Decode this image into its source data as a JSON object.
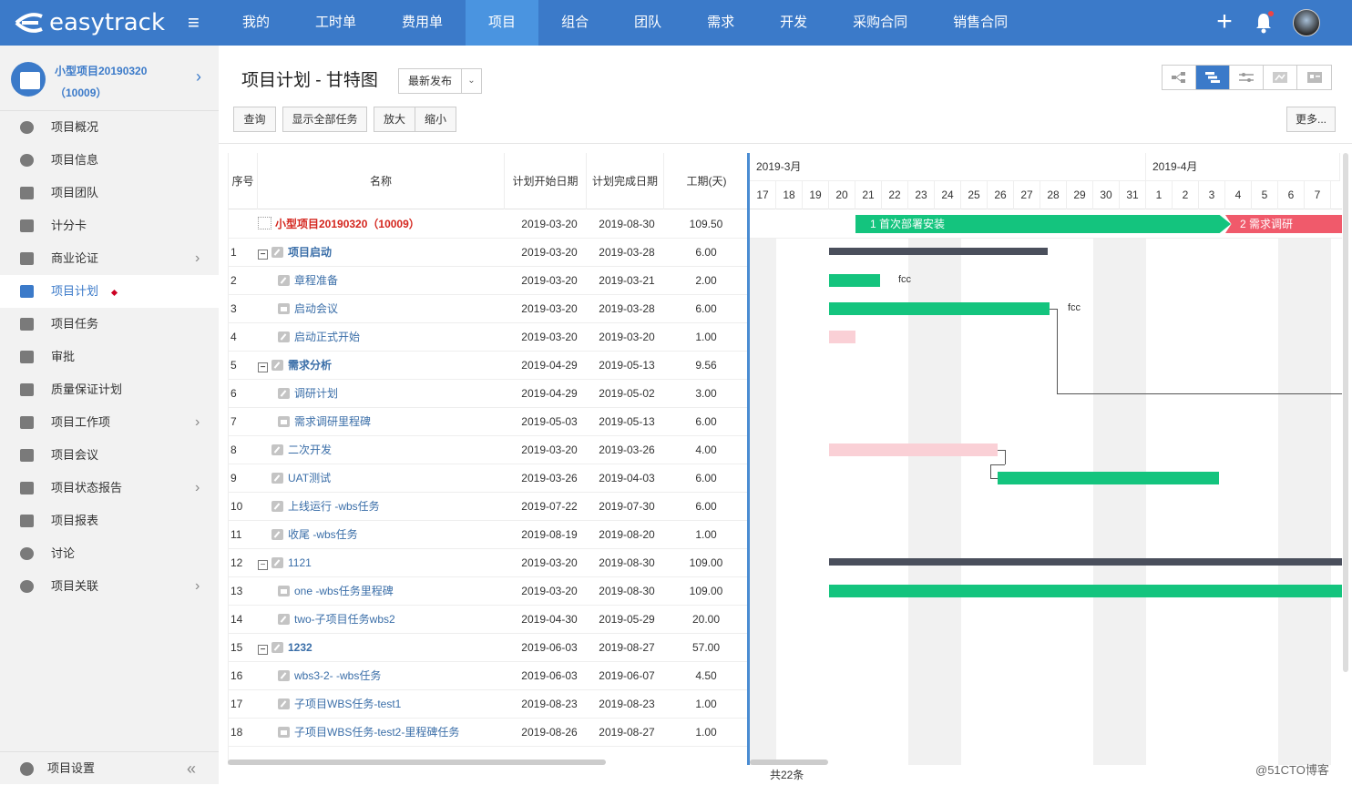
{
  "app": {
    "logo_text": "easytrack"
  },
  "nav": {
    "items": [
      {
        "label": "我的",
        "active": false
      },
      {
        "label": "工时单",
        "active": false
      },
      {
        "label": "费用单",
        "active": false
      },
      {
        "label": "项目",
        "active": true
      },
      {
        "label": "组合",
        "active": false
      },
      {
        "label": "团队",
        "active": false
      },
      {
        "label": "需求",
        "active": false
      },
      {
        "label": "开发",
        "active": false
      },
      {
        "label": "采购合同",
        "active": false
      },
      {
        "label": "销售合同",
        "active": false
      }
    ]
  },
  "sidebar": {
    "project_name": "小型项目20190320（10009）",
    "items": [
      {
        "label": "项目概况",
        "arrow": false,
        "active": false,
        "icon": "pie-chart-icon"
      },
      {
        "label": "项目信息",
        "arrow": false,
        "active": false,
        "icon": "info-icon"
      },
      {
        "label": "项目团队",
        "arrow": false,
        "active": false,
        "icon": "team-icon"
      },
      {
        "label": "计分卡",
        "arrow": false,
        "active": false,
        "icon": "scorecard-icon"
      },
      {
        "label": "商业论证",
        "arrow": true,
        "active": false,
        "icon": "flag-icon"
      },
      {
        "label": "项目计划",
        "arrow": false,
        "active": true,
        "icon": "plan-icon"
      },
      {
        "label": "项目任务",
        "arrow": false,
        "active": false,
        "icon": "task-icon"
      },
      {
        "label": "审批",
        "arrow": false,
        "active": false,
        "icon": "approval-icon"
      },
      {
        "label": "质量保证计划",
        "arrow": false,
        "active": false,
        "icon": "shield-icon"
      },
      {
        "label": "项目工作项",
        "arrow": true,
        "active": false,
        "icon": "list-icon"
      },
      {
        "label": "项目会议",
        "arrow": false,
        "active": false,
        "icon": "meeting-icon"
      },
      {
        "label": "项目状态报告",
        "arrow": true,
        "active": false,
        "icon": "report-icon"
      },
      {
        "label": "项目报表",
        "arrow": false,
        "active": false,
        "icon": "chart-icon"
      },
      {
        "label": "讨论",
        "arrow": false,
        "active": false,
        "icon": "chat-icon"
      },
      {
        "label": "项目关联",
        "arrow": true,
        "active": false,
        "icon": "link-icon"
      }
    ],
    "footer_label": "项目设置"
  },
  "page": {
    "title": "项目计划 - 甘特图",
    "version_select": "最新发布",
    "buttons": {
      "query": "查询",
      "show_all": "显示全部任务",
      "zoom_in": "放大",
      "zoom_out": "缩小",
      "more": "更多..."
    }
  },
  "grid": {
    "headers": {
      "seq": "序号",
      "name": "名称",
      "start": "计划开始日期",
      "end": "计划完成日期",
      "duration": "工期(天)"
    },
    "rows": [
      {
        "seq": "",
        "name": "小型项目20190320（10009）",
        "start": "2019-03-20",
        "end": "2019-08-30",
        "dur": "109.50",
        "type": "root",
        "level": 0
      },
      {
        "seq": "1",
        "name": "项目启动",
        "start": "2019-03-20",
        "end": "2019-03-28",
        "dur": "6.00",
        "type": "summary",
        "level": 1
      },
      {
        "seq": "2",
        "name": "章程准备",
        "start": "2019-03-20",
        "end": "2019-03-21",
        "dur": "2.00",
        "type": "task",
        "level": 2
      },
      {
        "seq": "3",
        "name": "启动会议",
        "start": "2019-03-20",
        "end": "2019-03-28",
        "dur": "6.00",
        "type": "milestone",
        "level": 2
      },
      {
        "seq": "4",
        "name": "启动正式开始",
        "start": "2019-03-20",
        "end": "2019-03-20",
        "dur": "1.00",
        "type": "task",
        "level": 2
      },
      {
        "seq": "5",
        "name": "需求分析",
        "start": "2019-04-29",
        "end": "2019-05-13",
        "dur": "9.56",
        "type": "summary",
        "level": 1
      },
      {
        "seq": "6",
        "name": "调研计划",
        "start": "2019-04-29",
        "end": "2019-05-02",
        "dur": "3.00",
        "type": "task",
        "level": 2
      },
      {
        "seq": "7",
        "name": "需求调研里程碑",
        "start": "2019-05-03",
        "end": "2019-05-13",
        "dur": "6.00",
        "type": "milestone",
        "level": 2
      },
      {
        "seq": "8",
        "name": "二次开发",
        "start": "2019-03-20",
        "end": "2019-03-26",
        "dur": "4.00",
        "type": "task",
        "level": 1
      },
      {
        "seq": "9",
        "name": "UAT测试",
        "start": "2019-03-26",
        "end": "2019-04-03",
        "dur": "6.00",
        "type": "task",
        "level": 1
      },
      {
        "seq": "10",
        "name": "上线运行 -wbs任务",
        "start": "2019-07-22",
        "end": "2019-07-30",
        "dur": "6.00",
        "type": "task",
        "level": 1
      },
      {
        "seq": "11",
        "name": "收尾 -wbs任务",
        "start": "2019-08-19",
        "end": "2019-08-20",
        "dur": "1.00",
        "type": "task",
        "level": 1
      },
      {
        "seq": "12",
        "name": "1121",
        "start": "2019-03-20",
        "end": "2019-08-30",
        "dur": "109.00",
        "type": "summary-plain",
        "level": 1
      },
      {
        "seq": "13",
        "name": "one -wbs任务里程碑",
        "start": "2019-03-20",
        "end": "2019-08-30",
        "dur": "109.00",
        "type": "milestone",
        "level": 2
      },
      {
        "seq": "14",
        "name": "two-子项目任务wbs2",
        "start": "2019-04-30",
        "end": "2019-05-29",
        "dur": "20.00",
        "type": "task",
        "level": 2
      },
      {
        "seq": "15",
        "name": "1232",
        "start": "2019-06-03",
        "end": "2019-08-27",
        "dur": "57.00",
        "type": "summary",
        "level": 1
      },
      {
        "seq": "16",
        "name": "wbs3-2- -wbs任务",
        "start": "2019-06-03",
        "end": "2019-06-07",
        "dur": "4.50",
        "type": "task",
        "level": 2
      },
      {
        "seq": "17",
        "name": "子项目WBS任务-test1",
        "start": "2019-08-23",
        "end": "2019-08-23",
        "dur": "1.00",
        "type": "task",
        "level": 2
      },
      {
        "seq": "18",
        "name": "子项目WBS任务-test2-里程碑任务",
        "start": "2019-08-26",
        "end": "2019-08-27",
        "dur": "1.00",
        "type": "milestone",
        "level": 2
      }
    ]
  },
  "gantt": {
    "months": [
      "2019-3月",
      "2019-4月"
    ],
    "days": [
      "17",
      "18",
      "19",
      "20",
      "21",
      "22",
      "23",
      "24",
      "25",
      "26",
      "27",
      "28",
      "29",
      "30",
      "31",
      "1",
      "2",
      "3",
      "4",
      "5",
      "6",
      "7"
    ],
    "phases": [
      {
        "label": "1 首次部署安装",
        "color": "#14c47e"
      },
      {
        "label": "2 需求调研",
        "color": "#f05a6b"
      }
    ],
    "bar_labels": {
      "row2": "fcc",
      "row3": "fcc"
    },
    "total_count": "共22条"
  },
  "watermark": "@51CTO博客",
  "colors": {
    "primary": "#3b7ac9",
    "accent_green": "#14c47e",
    "accent_pink": "#fad0d6",
    "summary_bar": "#4a4f5c",
    "root_text": "#d4261e"
  }
}
